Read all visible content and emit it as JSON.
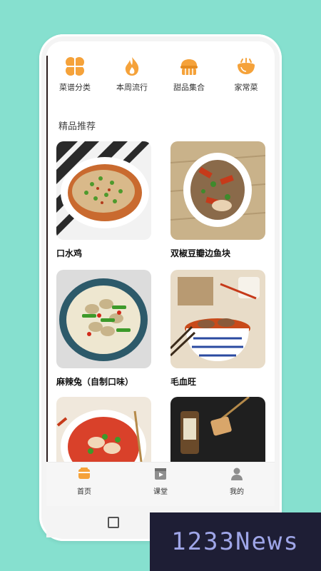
{
  "categories": [
    {
      "label": "菜谱分类",
      "icon": "clover-icon"
    },
    {
      "label": "本周流行",
      "icon": "flame-icon"
    },
    {
      "label": "甜品集合",
      "icon": "cake-icon"
    },
    {
      "label": "家常菜",
      "icon": "bowl-icon"
    }
  ],
  "section_title": "精品推荐",
  "recipes": [
    {
      "name": "口水鸡"
    },
    {
      "name": "双椒豆瓣边鱼块"
    },
    {
      "name": "麻辣兔（自制口味）"
    },
    {
      "name": "毛血旺"
    },
    {
      "name": ""
    },
    {
      "name": ""
    }
  ],
  "tabs": [
    {
      "label": "首页",
      "icon": "home-icon"
    },
    {
      "label": "课堂",
      "icon": "video-icon"
    },
    {
      "label": "我的",
      "icon": "user-icon"
    }
  ],
  "watermark": "1233News",
  "colors": {
    "accent": "#f5a23a",
    "background": "#86e0cf"
  }
}
